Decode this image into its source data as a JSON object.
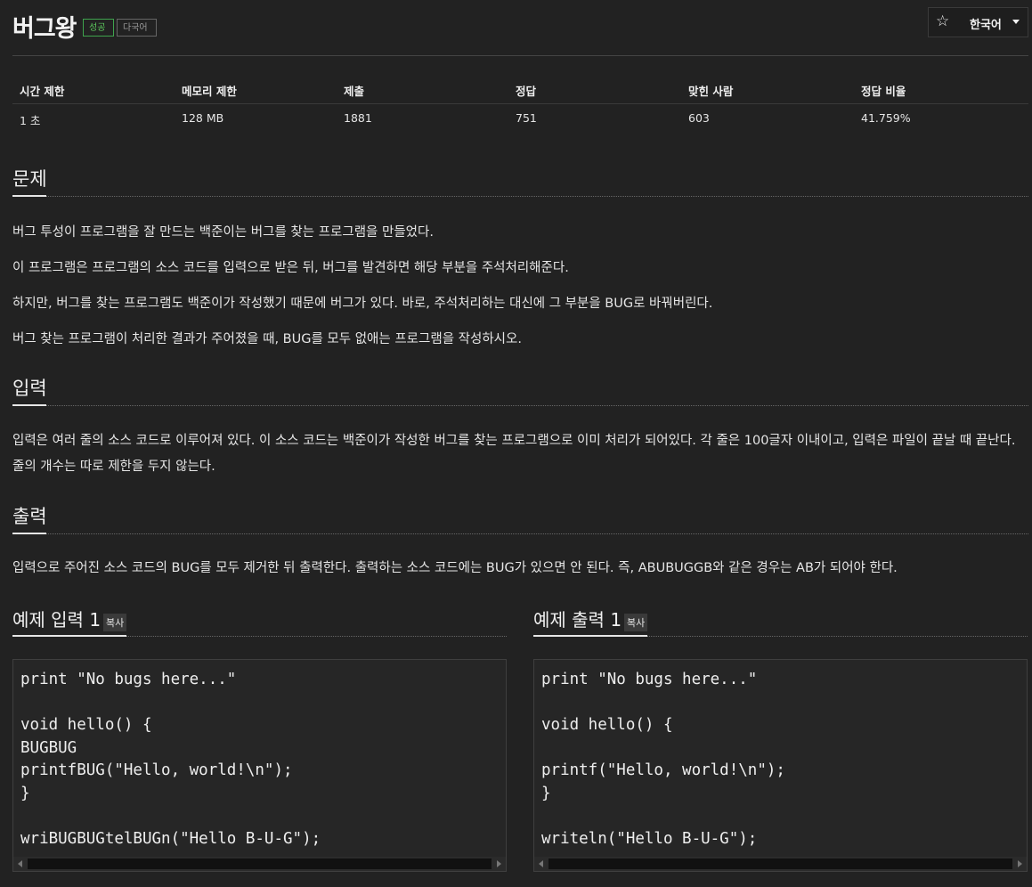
{
  "problem": {
    "title": "버그왕",
    "badges": {
      "success": "성공",
      "multilang": "다국어"
    },
    "language_selector": {
      "label": "한국어",
      "star_icon": "star-icon"
    }
  },
  "stats": {
    "headers": [
      "시간 제한",
      "메모리 제한",
      "제출",
      "정답",
      "맞힌 사람",
      "정답 비율"
    ],
    "values": [
      "1 초",
      "128 MB",
      "1881",
      "751",
      "603",
      "41.759%"
    ]
  },
  "sections": {
    "problem": {
      "heading": "문제",
      "paragraphs": [
        "버그 투성이 프로그램을 잘 만드는 백준이는 버그를 찾는 프로그램을 만들었다.",
        "이 프로그램은 프로그램의 소스 코드를 입력으로 받은 뒤, 버그를 발견하면 해당 부분을 주석처리해준다.",
        "하지만, 버그를 찾는 프로그램도 백준이가 작성했기 때문에 버그가 있다. 바로, 주석처리하는 대신에 그 부분을 BUG로 바꿔버린다.",
        "버그 찾는 프로그램이 처리한 결과가 주어졌을 때, BUG를 모두 없애는 프로그램을 작성하시오."
      ]
    },
    "input": {
      "heading": "입력",
      "text": "입력은 여러 줄의 소스 코드로 이루어져 있다. 이 소스 코드는 백준이가 작성한 버그를 찾는 프로그램으로 이미 처리가 되어있다. 각 줄은 100글자 이내이고, 입력은 파일이 끝날 때 끝난다. 줄의 개수는 따로 제한을 두지 않는다."
    },
    "output": {
      "heading": "출력",
      "text": "입력으로 주어진 소스 코드의 BUG를 모두 제거한 뒤 출력한다. 출력하는 소스 코드에는 BUG가 있으면 안 된다. 즉, ABUBUGGB와 같은 경우는 AB가 되어야 한다."
    }
  },
  "examples": {
    "input": {
      "heading": "예제 입력 1",
      "copy_label": "복사",
      "code": "print \"No bugs here...\"\n\nvoid hello() {\nBUGBUG\nprintfBUG(\"Hello, world!\\n\");\n}\n\nwriBUGBUGtelBUGn(\"Hello B-U-G\");"
    },
    "output": {
      "heading": "예제 출력 1",
      "copy_label": "복사",
      "code": "print \"No bugs here...\"\n\nvoid hello() {\n\nprintf(\"Hello, world!\\n\");\n}\n\nwriteln(\"Hello B-U-G\");"
    }
  }
}
